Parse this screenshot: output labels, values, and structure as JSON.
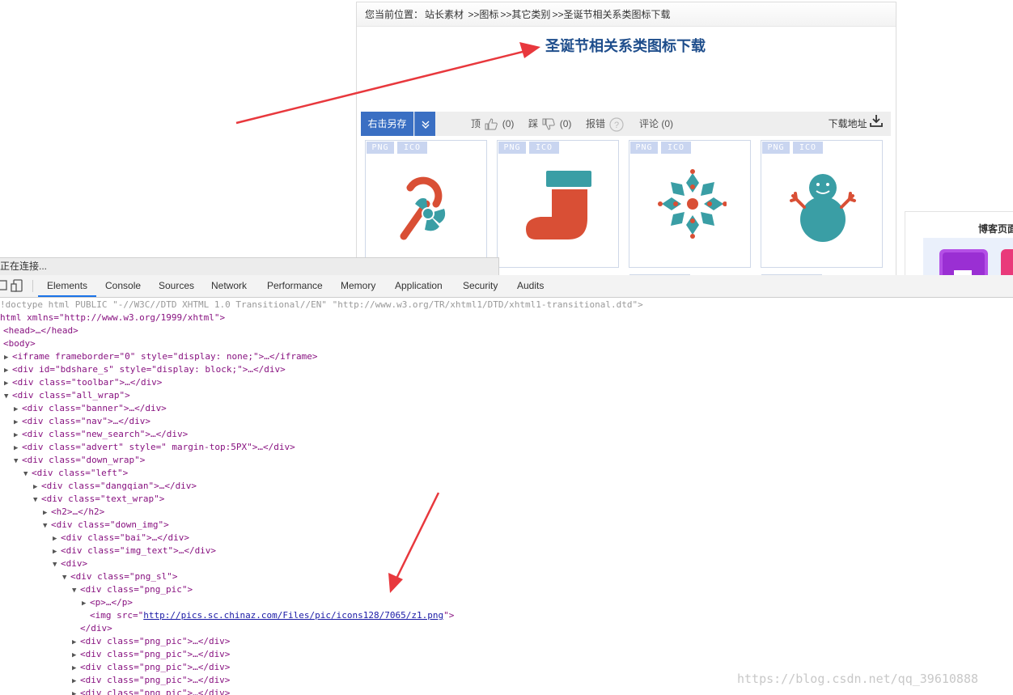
{
  "breadcrumb": {
    "prefix": "您当前位置：",
    "items": [
      "站长素材",
      ">>图标",
      ">>其它类别",
      ">>圣诞节相关系类图标下载"
    ]
  },
  "page": {
    "title": "圣诞节相关系类图标下载"
  },
  "toolbar": {
    "save_label": "右击另存",
    "dropdown_glyph": "»",
    "like_label": "顶",
    "like_count": "(0)",
    "dislike_label": "踩",
    "dislike_count": "(0)",
    "report_label": "报错",
    "comment_label": "评论",
    "comment_count": "(0)",
    "download_label": "下载地址"
  },
  "icon_cards": [
    {
      "png": "PNG",
      "ico": "ICO",
      "icon": "candy-cane-icon"
    },
    {
      "png": "PNG",
      "ico": "ICO",
      "icon": "christmas-stocking-icon"
    },
    {
      "png": "PNG",
      "ico": "ICO",
      "icon": "snowflake-holly-icon"
    },
    {
      "png": "PNG",
      "ico": "ICO",
      "icon": "snowman-icon"
    }
  ],
  "sidebar": {
    "title": "博客页面"
  },
  "status": "正在连接...",
  "devtools": {
    "tabs": [
      "Elements",
      "Console",
      "Sources",
      "Network",
      "Performance",
      "Memory",
      "Application",
      "Security",
      "Audits"
    ],
    "active_tab": "Elements"
  },
  "code_lines": {
    "l0": "!doctype html PUBLIC \"-//W3C//DTD XHTML 1.0 Transitional//EN\" \"http://www.w3.org/TR/xhtml1/DTD/xhtml1-transitional.dtd\">",
    "l1": "html xmlns=\"http://www.w3.org/1999/xhtml\">",
    "l2": "<head>…</head>",
    "l3": "<body>",
    "l4": "<iframe frameborder=\"0\" style=\"display: none;\">…</iframe>",
    "l5": "<div id=\"bdshare_s\" style=\"display: block;\">…</div>",
    "l6": "<div class=\"toolbar\">…</div>",
    "l7": "<div class=\"all_wrap\">",
    "l8": "<div class=\"banner\">…</div>",
    "l9": "<div class=\"nav\">…</div>",
    "l10": "<div class=\"new_search\">…</div>",
    "l11": "<div class=\"advert\" style=\" margin-top:5PX\">…</div>",
    "l12": "<div class=\"down_wrap\">",
    "l13": "<div class=\"left\">",
    "l14": "<div class=\"dangqian\">…</div>",
    "l15": "<div class=\"text_wrap\">",
    "l16": "<h2>…</h2>",
    "l17": "<div class=\"down_img\">",
    "l18": "<div class=\"bai\">…</div>",
    "l19": "<div class=\"img_text\">…</div>",
    "l20": "<div>",
    "l21": "<div class=\"png_sl\">",
    "l22": "<div class=\"png_pic\">",
    "l23": "<p>…</p>",
    "l24_pre": "<img src=\"",
    "l24_link": "http://pics.sc.chinaz.com/Files/pic/icons128/7065/z1.png",
    "l24_post": "\">",
    "l25": "</div>",
    "l26": "<div class=\"png_pic\">…</div>",
    "l27": "<div class=\"png_pic\">…</div>",
    "l28": "<div class=\"png_pic\">…</div>",
    "l29": "<div class=\"png_pic\">…</div>",
    "l30": "<div class=\"png_pic\">…</div>"
  },
  "watermark": "https://blog.csdn.net/qq_39610888",
  "colors": {
    "accent_blue": "#3a6fc3",
    "title_blue": "#1f4e8c",
    "arrow_red": "#e8383d",
    "icon_red": "#d94f35",
    "icon_teal": "#3a9ea5"
  }
}
